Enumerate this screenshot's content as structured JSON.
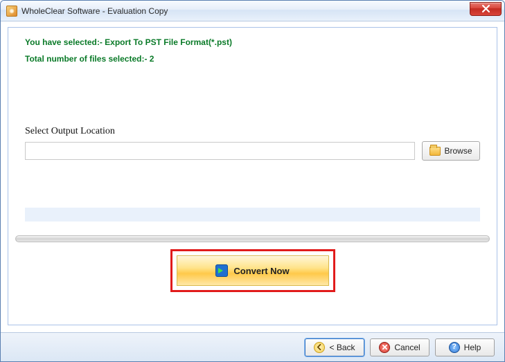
{
  "window": {
    "title": "WholeClear Software - Evaluation Copy"
  },
  "info": {
    "selection_line": "You have selected:- Export To PST File Format(*.pst)",
    "count_line": "Total number of files selected:- 2"
  },
  "output": {
    "label": "Select Output Location",
    "path_value": "",
    "browse_label": "Browse"
  },
  "action": {
    "convert_label": "Convert Now"
  },
  "footer": {
    "back_label": "< Back",
    "cancel_label": "Cancel",
    "help_label": "Help"
  }
}
